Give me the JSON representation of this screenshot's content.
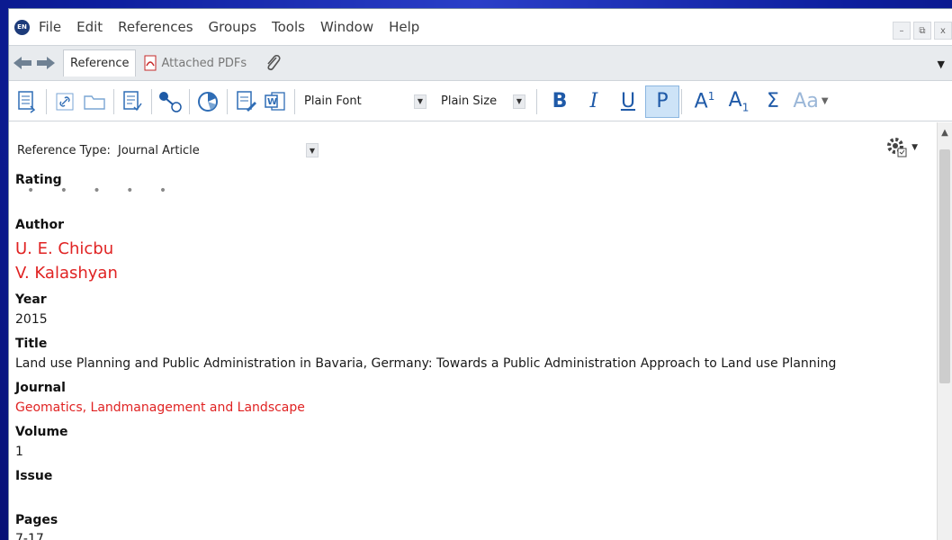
{
  "menu": {
    "logo_text": "EN",
    "items": [
      "File",
      "Edit",
      "References",
      "Groups",
      "Tools",
      "Window",
      "Help"
    ]
  },
  "tabs": {
    "reference": "Reference",
    "attached_pdfs": "Attached PDFs"
  },
  "toolbar": {
    "font_select": "Plain Font",
    "size_select": "Plain Size",
    "bold": "B",
    "italic": "I",
    "underline": "U",
    "plain": "P",
    "sigma": "Σ",
    "case": "Aa"
  },
  "reference": {
    "type_label": "Reference Type:",
    "type_value": "Journal Article",
    "rating_label": "Rating",
    "rating_dots": "• • • • •",
    "author_label": "Author",
    "authors": [
      "U. E. Chicbu",
      "V. Kalashyan"
    ],
    "year_label": "Year",
    "year": "2015",
    "title_label": "Title",
    "title": "Land use Planning and Public Administration in Bavaria, Germany: Towards a Public Administration Approach to Land use Planning",
    "journal_label": "Journal",
    "journal": "Geomatics, Landmanagement and Landscape",
    "volume_label": "Volume",
    "volume": "1",
    "issue_label": "Issue",
    "issue": "",
    "pages_label": "Pages",
    "pages": "7-17"
  },
  "colors": {
    "accent_blue": "#1f5aa8",
    "term_red": "#e02323",
    "highlight": "#cde3f7"
  }
}
